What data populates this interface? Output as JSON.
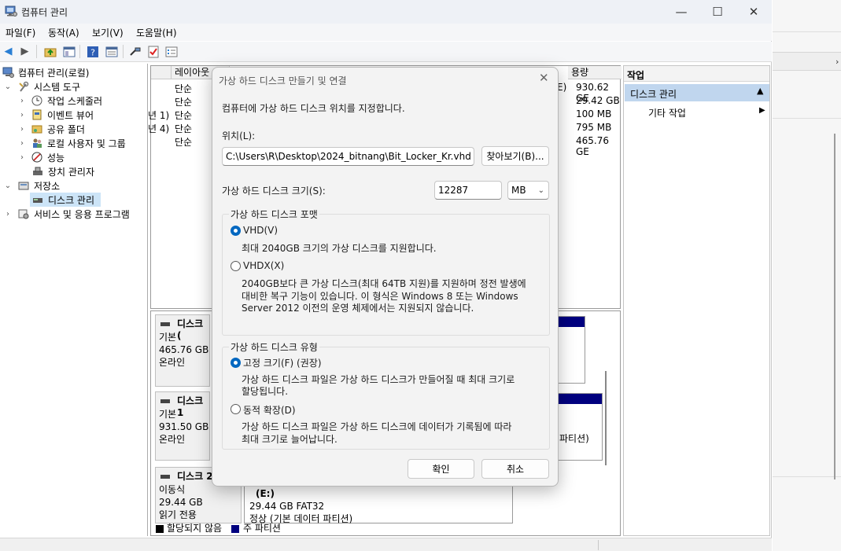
{
  "window": {
    "title": "컴퓨터 관리"
  },
  "menu": [
    "파일(F)",
    "동작(A)",
    "보기(V)",
    "도움말(H)"
  ],
  "tree": [
    {
      "label": "컴퓨터 관리(로컬)"
    },
    {
      "label": "시스템 도구"
    },
    {
      "label": "작업 스케줄러"
    },
    {
      "label": "이벤트 뷰어"
    },
    {
      "label": "공유 폴더"
    },
    {
      "label": "로컬 사용자 및 그룹"
    },
    {
      "label": "성능"
    },
    {
      "label": "장치 관리자"
    },
    {
      "label": "저장소"
    },
    {
      "label": "디스크 관리"
    },
    {
      "label": "서비스 및 응용 프로그램"
    }
  ],
  "list": {
    "headers": {
      "layout": "레이아웃",
      "capacity": "용량"
    },
    "rows": [
      {
        "prefix": "",
        "type": "단순",
        "cap": "930.62 GE",
        "mid": "E)"
      },
      {
        "prefix": "",
        "type": "단순",
        "cap": "29.42 GB",
        "mid": ""
      },
      {
        "prefix": "년 1)",
        "type": "단순",
        "cap": "100 MB",
        "mid": ""
      },
      {
        "prefix": "년 4)",
        "type": "단순",
        "cap": "795 MB",
        "mid": ""
      },
      {
        "prefix": "",
        "type": "단순",
        "cap": "465.76 GE",
        "mid": ""
      }
    ]
  },
  "disks": [
    {
      "name": "디스크 (",
      "kind": "기본",
      "size": "465.76 GB",
      "state": "온라인"
    },
    {
      "name": "디스크 1",
      "kind": "기본",
      "size": "931.50 GB",
      "state": "온라인"
    },
    {
      "name": "디스크 2",
      "kind": "이동식",
      "size": "29.44 GB",
      "state": "읽기 전용"
    }
  ],
  "partitions": {
    "disk1_tail": "파티션)",
    "e_label": "(E:)",
    "e_size": "29.44 GB FAT32",
    "e_state": "정상 (기본 데이터 파티션)"
  },
  "legend": {
    "unallocated": "할당되지 않음",
    "primary": "주 파티션"
  },
  "actions": {
    "header": "작업",
    "selected": "디스크 관리",
    "more": "기타 작업"
  },
  "dialog": {
    "title": "가상 하드 디스크 만들기 및 연결",
    "intro": "컴퓨터에 가상 하드 디스크 위치를 지정합니다.",
    "location_label": "위치(L):",
    "location_value": "C:\\Users\\R\\Desktop\\2024_bitnang\\Bit_Locker_Kr.vhd",
    "browse": "찾아보기(B)...",
    "size_label": "가상 하드 디스크 크기(S):",
    "size_value": "12287",
    "size_unit": "MB",
    "format_group": "가상 하드 디스크 포맷",
    "vhd": "VHD(V)",
    "vhd_desc": "최대 2040GB 크기의 가상 디스크를 지원합니다.",
    "vhdx": "VHDX(X)",
    "vhdx_desc1": "2040GB보다 큰 가상 디스크(최대 64TB 지원)를 지원하며 정전 발생에",
    "vhdx_desc2": "대비한 복구 기능이 있습니다. 이 형식은 Windows 8 또는 Windows",
    "vhdx_desc3": "Server 2012 이전의 운영 체제에서는 지원되지 않습니다.",
    "type_group": "가상 하드 디스크 유형",
    "fixed": "고정 크기(F) (권장)",
    "fixed_desc1": "가상 하드 디스크 파일은 가상 하드 디스크가 만들어질 때 최대 크기로",
    "fixed_desc2": "할당됩니다.",
    "dynamic": "동적 확장(D)",
    "dynamic_desc1": "가상 하드 디스크 파일은 가상 하드 디스크에 데이터가 기록됨에 따라",
    "dynamic_desc2": "최대 크기로 늘어납니다.",
    "ok": "확인",
    "cancel": "취소"
  },
  "colors": {
    "accent": "#0067c0",
    "primary_partition": "#00007f",
    "selection": "#cce4f7"
  }
}
